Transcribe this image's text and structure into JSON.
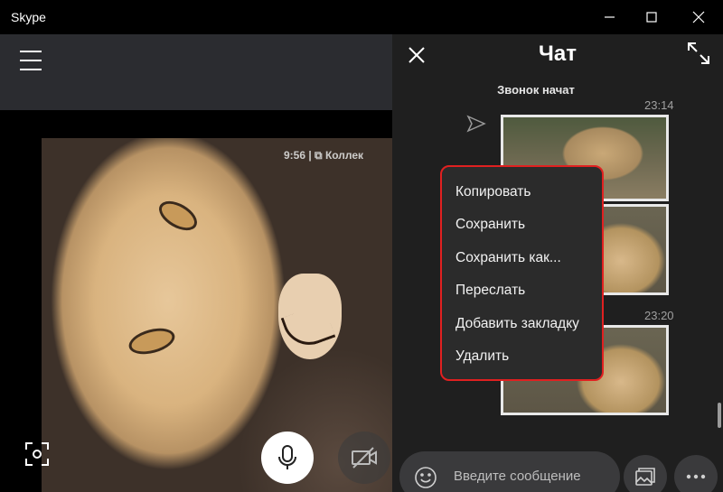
{
  "window": {
    "title": "Skype"
  },
  "call": {
    "video_overlay": "9:56  |  ⧉ Коллек"
  },
  "chat": {
    "title": "Чат",
    "system_message": "Звонок начат",
    "messages": [
      {
        "time": "23:14"
      },
      {
        "time": "23:20"
      }
    ],
    "composer_placeholder": "Введите сообщение"
  },
  "context_menu": {
    "items": [
      {
        "label": "Копировать"
      },
      {
        "label": "Сохранить"
      },
      {
        "label": "Сохранить как..."
      },
      {
        "label": "Переслать"
      },
      {
        "label": "Добавить закладку"
      },
      {
        "label": "Удалить"
      }
    ],
    "highlight_color": "#e02020"
  },
  "colors": {
    "titlebar_bg": "#000000",
    "chat_bg": "#1f1f1f",
    "menu_bg": "#2b2b2b"
  },
  "icons": [
    "minimize-icon",
    "maximize-icon",
    "close-icon",
    "hamburger-icon",
    "focus-icon",
    "microphone-icon",
    "camera-off-icon",
    "chat-close-icon",
    "expand-icon",
    "send-icon",
    "emoji-icon",
    "gallery-icon",
    "more-icon"
  ]
}
